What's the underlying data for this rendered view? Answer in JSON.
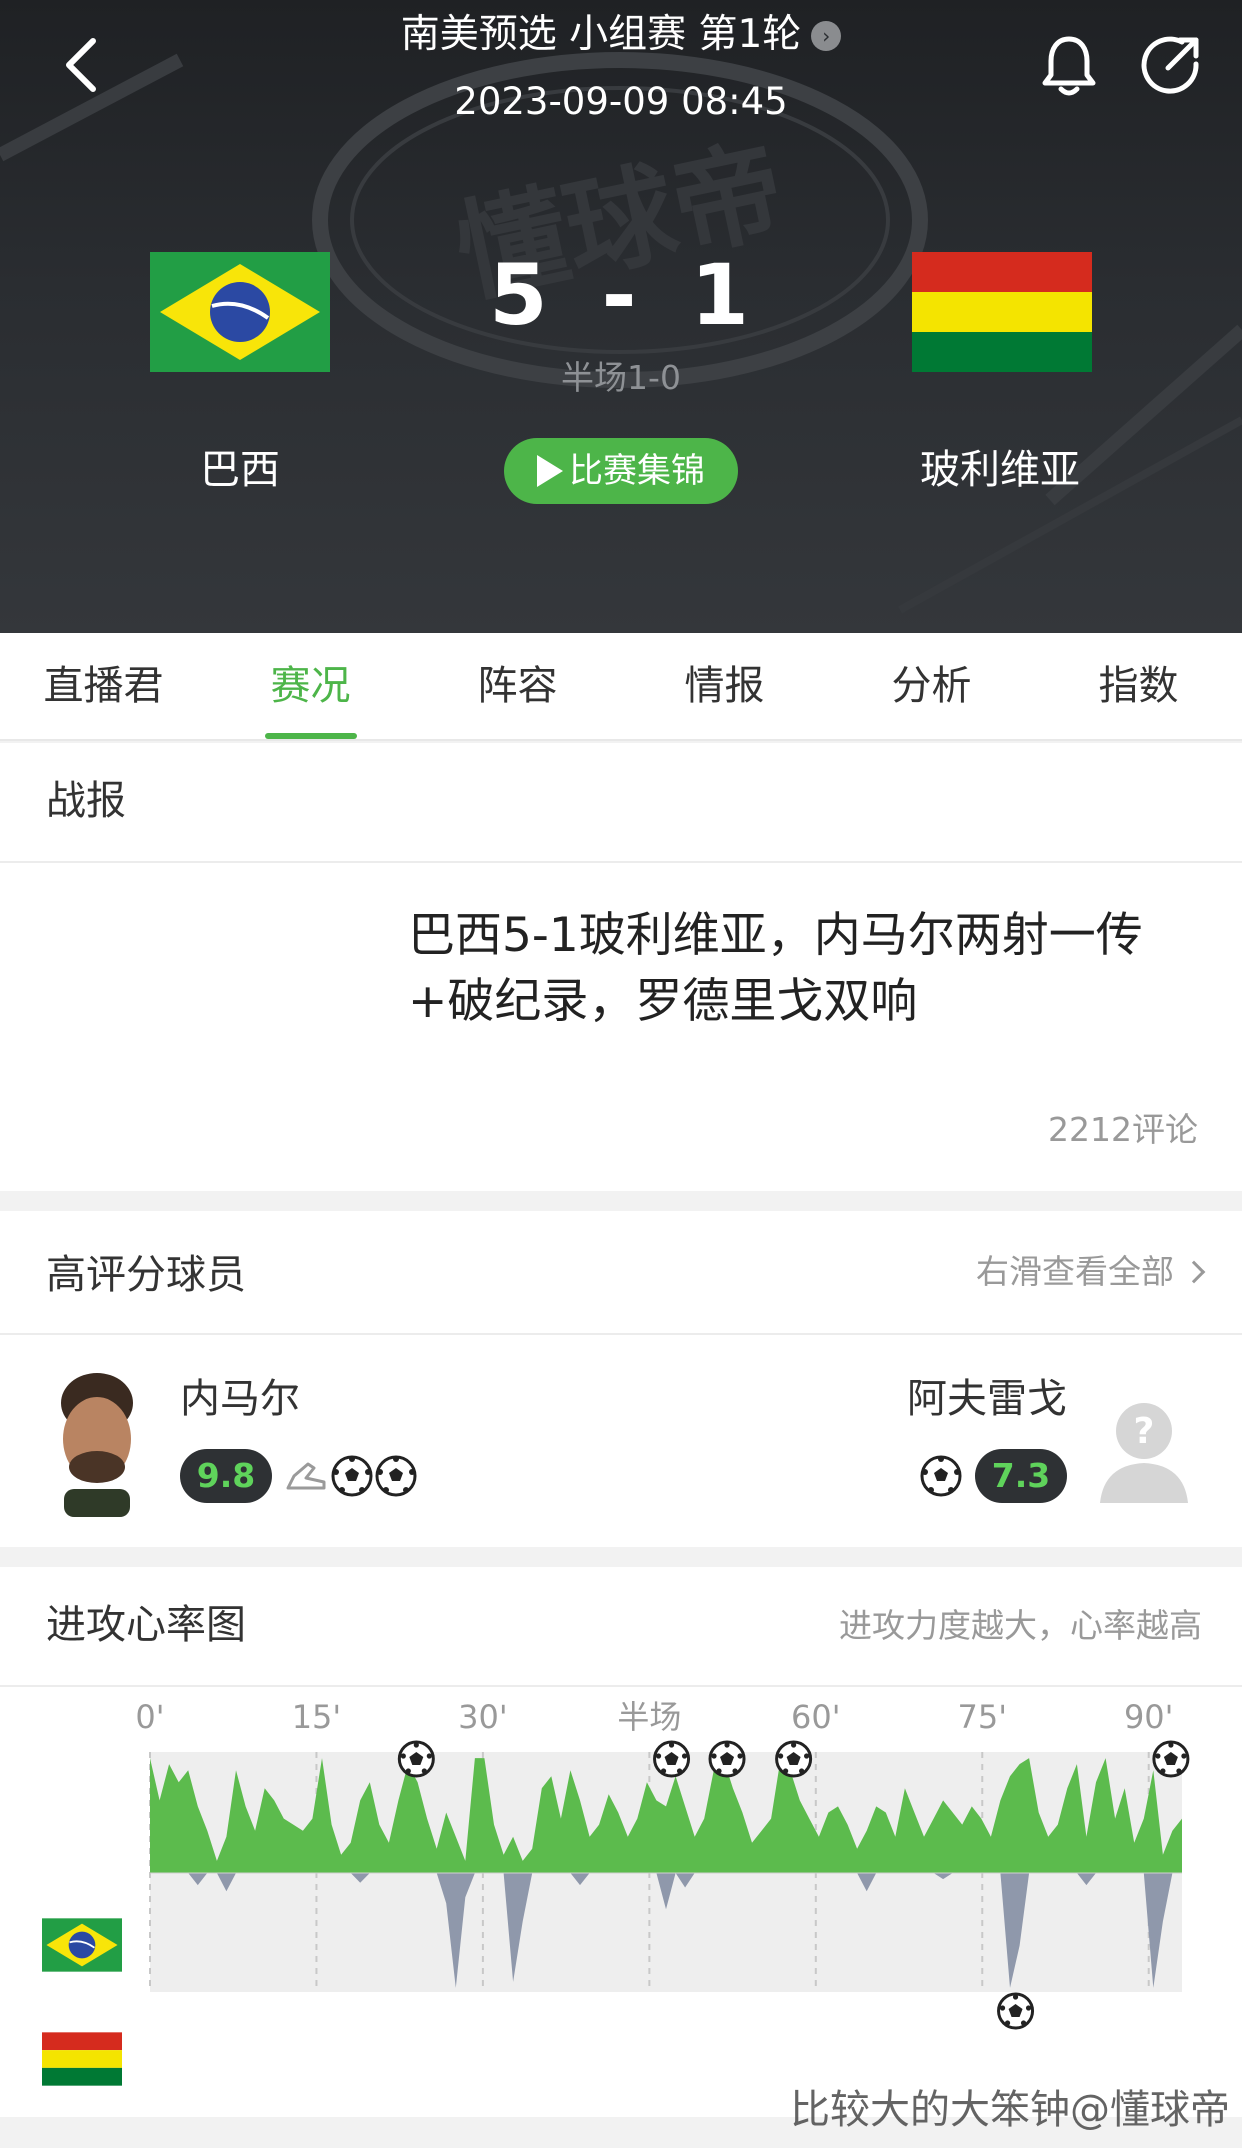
{
  "header": {
    "competition": "南美预选 小组赛 第1轮",
    "match_time": "2023-09-09 08:45",
    "score_home": "5",
    "score_sep": "-",
    "score_away": "1",
    "halftime": "半场1-0",
    "home_team": "巴西",
    "away_team": "玻利维亚",
    "highlights_label": "比赛集锦",
    "icons": [
      "back-icon",
      "bell-icon",
      "share-icon",
      "info-icon",
      "play-icon"
    ],
    "colors": {
      "brand_green": "#4db549",
      "header_bg": "#2a2d31"
    }
  },
  "tabs": [
    {
      "label": "直播君",
      "active": false
    },
    {
      "label": "赛况",
      "active": true
    },
    {
      "label": "阵容",
      "active": false
    },
    {
      "label": "情报",
      "active": false
    },
    {
      "label": "分析",
      "active": false
    },
    {
      "label": "指数",
      "active": false
    }
  ],
  "report": {
    "section_title": "战报",
    "headline_line1": "巴西5-1玻利维亚，内马尔两射一传",
    "headline_line2": "+破纪录，罗德里戈双响",
    "comments": "2212评论"
  },
  "top_players": {
    "section_title": "高评分球员",
    "swipe_hint": "右滑查看全部",
    "home_player": {
      "name": "内马尔",
      "rating": "9.8",
      "events": [
        "assist-boot-icon",
        "goal-ball-icon",
        "goal-ball-icon"
      ]
    },
    "away_player": {
      "name": "阿夫雷戈",
      "rating": "7.3",
      "events": [
        "goal-ball-icon"
      ]
    }
  },
  "attack_chart": {
    "section_title": "进攻心率图",
    "hint": "进攻力度越大，心率越高"
  },
  "chart_data": {
    "type": "area",
    "x_ticks": [
      "0'",
      "15'",
      "30'",
      "半场",
      "60'",
      "75'",
      "90'"
    ],
    "x_tick_minutes": [
      0,
      15,
      30,
      45,
      60,
      75,
      90
    ],
    "xlim": [
      0,
      93
    ],
    "ylim": [
      -1,
      1
    ],
    "grid": true,
    "series": [
      {
        "team": "home",
        "values": [
          0.95,
          0.6,
          0.9,
          0.75,
          0.85,
          0.55,
          0.35,
          0.1,
          0.3,
          0.85,
          0.55,
          0.35,
          0.7,
          0.6,
          0.45,
          0.4,
          0.35,
          0.45,
          0.95,
          0.4,
          0.15,
          0.25,
          0.6,
          0.75,
          0.4,
          0.25,
          0.6,
          0.9,
          0.75,
          0.45,
          0.2,
          0.5,
          0.3,
          0.1,
          0.95,
          0.95,
          0.4,
          0.15,
          0.3,
          0.1,
          0.2,
          0.7,
          0.8,
          0.45,
          0.85,
          0.6,
          0.3,
          0.4,
          0.65,
          0.5,
          0.3,
          0.45,
          0.75,
          0.6,
          0.55,
          0.8,
          0.55,
          0.3,
          0.45,
          0.85,
          0.95,
          0.7,
          0.5,
          0.25,
          0.35,
          0.45,
          0.95,
          0.85,
          0.6,
          0.45,
          0.3,
          0.5,
          0.55,
          0.4,
          0.2,
          0.35,
          0.55,
          0.5,
          0.3,
          0.7,
          0.5,
          0.3,
          0.45,
          0.6,
          0.5,
          0.4,
          0.55,
          0.45,
          0.3,
          0.6,
          0.8,
          0.9,
          0.95,
          0.5,
          0.3,
          0.4,
          0.7,
          0.9,
          0.3,
          0.75,
          0.95,
          0.45,
          0.7,
          0.25,
          0.45,
          0.85,
          0.15,
          0.35,
          0.45
        ],
        "color": "#5cbb4d"
      },
      {
        "team": "away",
        "values": [
          0,
          0,
          0,
          0,
          0,
          -0.1,
          0,
          0,
          -0.15,
          0,
          0,
          0,
          0,
          0,
          0,
          0,
          0,
          0,
          0,
          0,
          0,
          0,
          -0.08,
          0,
          0,
          0,
          0,
          0,
          0,
          0,
          0,
          -0.25,
          -0.95,
          -0.2,
          0,
          0,
          0,
          0,
          -0.9,
          -0.4,
          0,
          0,
          0,
          0,
          0,
          -0.1,
          0,
          0,
          0,
          0,
          0,
          0,
          0,
          0,
          -0.3,
          0,
          -0.12,
          0,
          0,
          0,
          0,
          0,
          0,
          0,
          0,
          0,
          0,
          0,
          0,
          0,
          0,
          0,
          0,
          0,
          0,
          -0.15,
          0,
          0,
          0,
          0,
          0,
          0,
          0,
          -0.05,
          0,
          0,
          0,
          0,
          0,
          0,
          -0.95,
          -0.6,
          0,
          0,
          0,
          0,
          0,
          0,
          -0.1,
          0,
          0,
          0,
          0,
          0,
          0,
          -0.95,
          -0.4,
          0,
          0
        ],
        "color": "#8f98ab"
      }
    ],
    "home_goals_minutes": [
      24,
      47,
      52,
      58,
      92
    ],
    "away_goals_minutes": [
      78
    ]
  },
  "watermark": "比较大的大笨钟@懂球帝"
}
